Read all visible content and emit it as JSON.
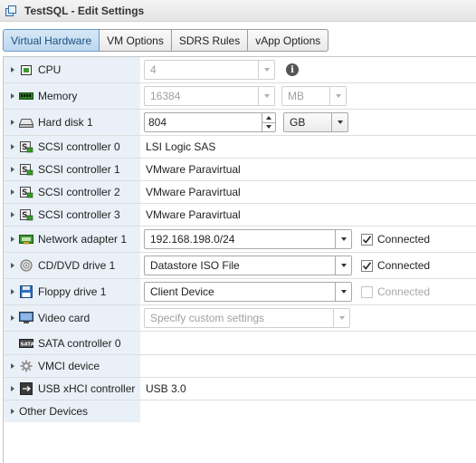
{
  "window": {
    "title": "TestSQL - Edit Settings"
  },
  "tabs": [
    {
      "label": "Virtual Hardware",
      "active": true
    },
    {
      "label": "VM Options",
      "active": false
    },
    {
      "label": "SDRS Rules",
      "active": false
    },
    {
      "label": "vApp Options",
      "active": false
    }
  ],
  "hardware": {
    "cpu": {
      "label": "CPU",
      "value": "4"
    },
    "memory": {
      "label": "Memory",
      "value": "16384",
      "unit": "MB"
    },
    "hard_disk_1": {
      "label": "Hard disk 1",
      "value": "804",
      "unit": "GB"
    },
    "scsi_0": {
      "label": "SCSI controller 0",
      "value": "LSI Logic SAS"
    },
    "scsi_1": {
      "label": "SCSI controller 1",
      "value": "VMware Paravirtual"
    },
    "scsi_2": {
      "label": "SCSI controller 2",
      "value": "VMware Paravirtual"
    },
    "scsi_3": {
      "label": "SCSI controller 3",
      "value": "VMware Paravirtual"
    },
    "network_adapter_1": {
      "label": "Network adapter 1",
      "value": "192.168.198.0/24",
      "checkbox_label": "Connected",
      "checked": true
    },
    "cd_dvd_drive_1": {
      "label": "CD/DVD drive 1",
      "value": "Datastore ISO File",
      "checkbox_label": "Connected",
      "checked": true
    },
    "floppy_drive_1": {
      "label": "Floppy drive 1",
      "value": "Client Device",
      "checkbox_label": "Connected",
      "checked": false
    },
    "video_card": {
      "label": "Video card",
      "value": "Specify custom settings"
    },
    "sata_controller_0": {
      "label": "SATA controller 0"
    },
    "vmci_device": {
      "label": "VMCI device"
    },
    "usb_xhci_controller": {
      "label": "USB xHCI controller",
      "value": "USB 3.0"
    },
    "other_devices": {
      "label": "Other Devices"
    }
  },
  "colors": {
    "active_tab": "#bcd7ef",
    "label_column_bg": "#e9f0f7"
  }
}
